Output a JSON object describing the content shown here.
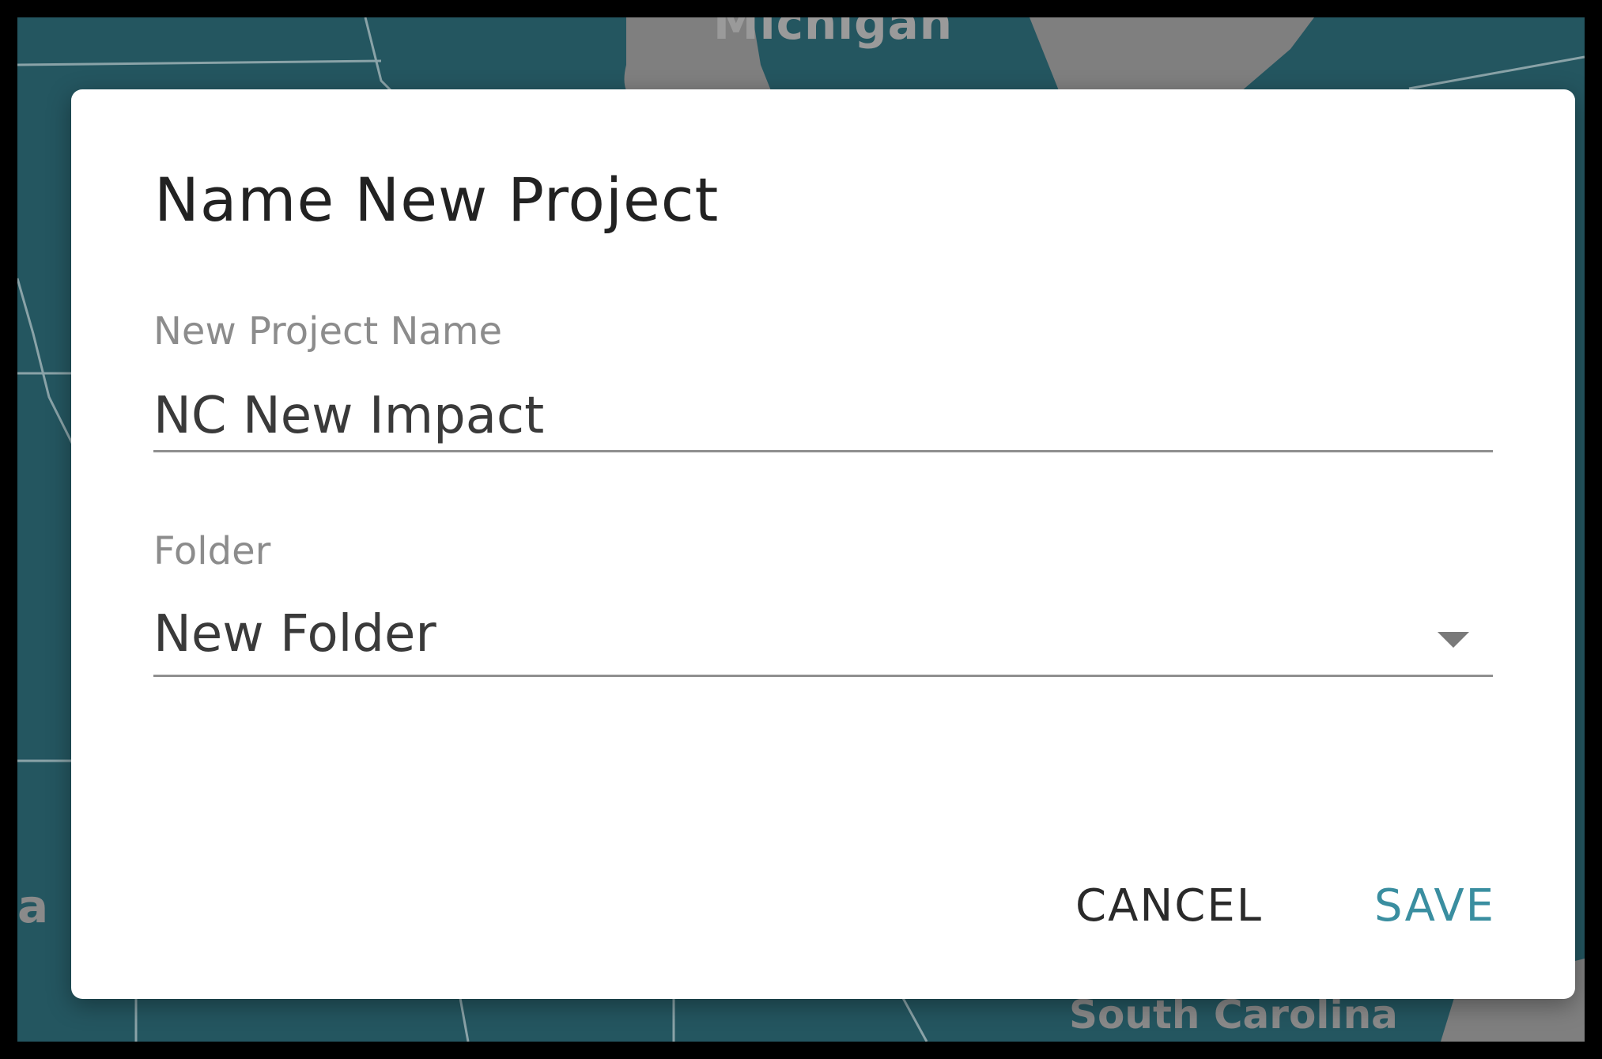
{
  "map": {
    "label": "Michigan",
    "fragments": [
      "a",
      "South Carolina"
    ]
  },
  "dialog": {
    "title": "Name New Project",
    "project_name_label": "New Project Name",
    "project_name_value": "NC New Impact",
    "folder_label": "Folder",
    "folder_value": "New Folder",
    "cancel_label": "CANCEL",
    "save_label": "SAVE"
  },
  "colors": {
    "map_water": "#245660",
    "map_land": "#7f7f7f",
    "accent": "#3a8ea0"
  }
}
